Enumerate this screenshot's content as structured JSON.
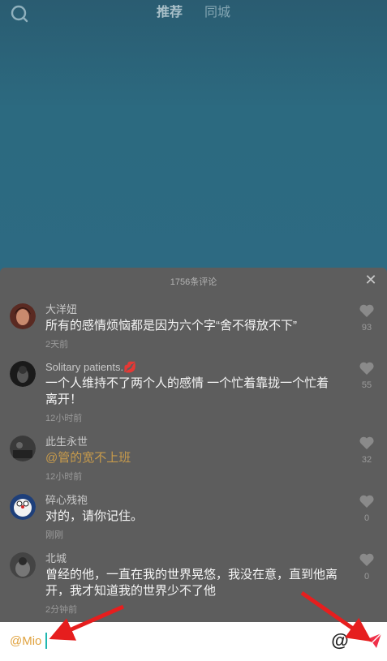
{
  "header": {
    "tabs": [
      {
        "label": "推荐"
      },
      {
        "label": "同城"
      }
    ]
  },
  "comments_panel": {
    "count_label": "1756条评论",
    "comments": [
      {
        "user": "大洋妞",
        "text": "所有的感情烦恼都是因为六个字“舍不得放不下”",
        "time": "2天前",
        "likes": "93"
      },
      {
        "user": "Solitary patients.💋",
        "text": "一个人维持不了两个人的感情 一个忙着靠拢一个忙着离开！",
        "time": "12小时前",
        "likes": "55"
      },
      {
        "user": "此生永世",
        "text": "@管的宽不上班",
        "time": "12小时前",
        "likes": "32"
      },
      {
        "user": "碎心残袍",
        "text": "对的，请你记住。",
        "time": "刚刚",
        "likes": "0"
      },
      {
        "user": "北城",
        "text": "曾经的他，一直在我的世界晃悠，我没在意，直到他离开，我才知道我的世界少不了他",
        "time": "2分钟前",
        "likes": "0"
      }
    ]
  },
  "input_bar": {
    "value": "@Mio",
    "at_label": "@"
  },
  "colors": {
    "mention": "#c89b4b",
    "input_text": "#e0a23e",
    "send": "#f0304a",
    "annotation_arrow": "#e61e1e"
  }
}
